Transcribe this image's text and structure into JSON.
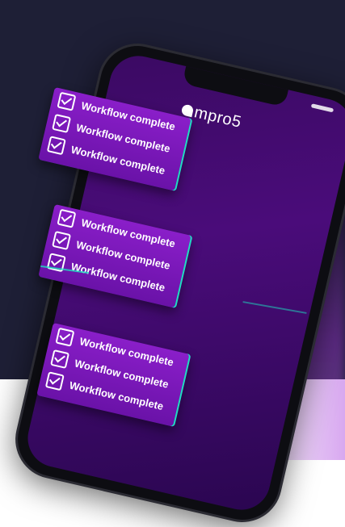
{
  "brand": {
    "logo_text": "mpro5"
  },
  "cards": [
    {
      "rows": [
        {
          "label": "Workflow complete"
        },
        {
          "label": "Workflow complete"
        },
        {
          "label": "Workflow complete"
        }
      ]
    },
    {
      "rows": [
        {
          "label": "Workflow complete"
        },
        {
          "label": "Workflow complete"
        },
        {
          "label": "Workflow complete"
        }
      ]
    },
    {
      "rows": [
        {
          "label": "Workflow complete"
        },
        {
          "label": "Workflow complete"
        },
        {
          "label": "Workflow complete"
        }
      ]
    }
  ],
  "colors": {
    "background_dark": "#1e1f36",
    "card_purple": "#7a18b8",
    "accent_teal": "#1ce0c0"
  },
  "icons": [
    "checkbox-checked-icon",
    "mpro5-logo-mark"
  ]
}
